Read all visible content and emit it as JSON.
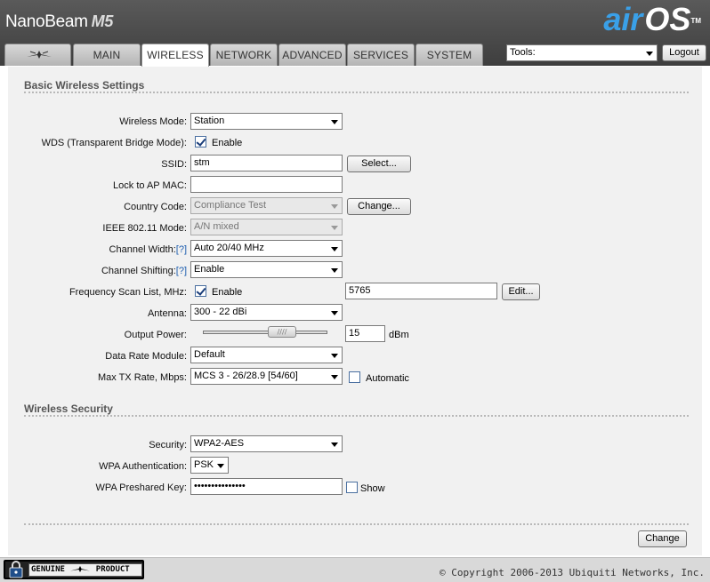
{
  "header": {
    "product": "NanoBeam",
    "model": "M5",
    "brand_air": "air",
    "brand_os": "OS",
    "brand_tm": "TM"
  },
  "tabs": [
    {
      "label": "",
      "icon": "ubiquiti-logo-icon"
    },
    {
      "label": "MAIN"
    },
    {
      "label": "WIRELESS",
      "active": true
    },
    {
      "label": "NETWORK"
    },
    {
      "label": "ADVANCED"
    },
    {
      "label": "SERVICES"
    },
    {
      "label": "SYSTEM"
    }
  ],
  "tools": {
    "value": "Tools:",
    "logout": "Logout"
  },
  "basic": {
    "title": "Basic Wireless Settings",
    "wireless_mode": {
      "label": "Wireless Mode:",
      "value": "Station"
    },
    "wds": {
      "label": "WDS (Transparent Bridge Mode):",
      "checked": true,
      "text": "Enable"
    },
    "ssid": {
      "label": "SSID:",
      "value": "stm",
      "button": "Select..."
    },
    "lock_ap": {
      "label": "Lock to AP MAC:",
      "value": ""
    },
    "country": {
      "label": "Country Code:",
      "value": "Compliance Test",
      "button": "Change..."
    },
    "ieee": {
      "label": "IEEE 802.11 Mode:",
      "value": "A/N mixed"
    },
    "channel_width": {
      "label": "Channel Width:",
      "help": "[?]",
      "value": "Auto 20/40 MHz"
    },
    "channel_shifting": {
      "label": "Channel Shifting:",
      "help": "[?]",
      "value": "Enable"
    },
    "freq_scan": {
      "label": "Frequency Scan List, MHz:",
      "checked": true,
      "text": "Enable",
      "value": "5765",
      "button": "Edit..."
    },
    "antenna": {
      "label": "Antenna:",
      "value": "300 - 22 dBi"
    },
    "output_power": {
      "label": "Output Power:",
      "value": "15",
      "unit": "dBm",
      "slider_fraction": 0.53
    },
    "data_rate": {
      "label": "Data Rate Module:",
      "value": "Default"
    },
    "max_tx": {
      "label": "Max TX Rate, Mbps:",
      "value": "MCS 3 - 26/28.9 [54/60]",
      "auto_checked": false,
      "auto_text": "Automatic"
    }
  },
  "security": {
    "title": "Wireless Security",
    "security": {
      "label": "Security:",
      "value": "WPA2-AES"
    },
    "wpa_auth": {
      "label": "WPA Authentication:",
      "value": "PSK"
    },
    "wpa_key": {
      "label": "WPA Preshared Key:",
      "value": "•••••••••••••••",
      "show_checked": false,
      "show_text": "Show"
    }
  },
  "change_button": "Change",
  "footer": {
    "badge_left": "GENUINE",
    "badge_right": "PRODUCT",
    "copyright": "© Copyright 2006-2013 Ubiquiti Networks, Inc."
  },
  "colors": {
    "header": "#3e3e3e",
    "brand_air": "#3aa0e8",
    "content_bg": "#f1f1f1"
  }
}
